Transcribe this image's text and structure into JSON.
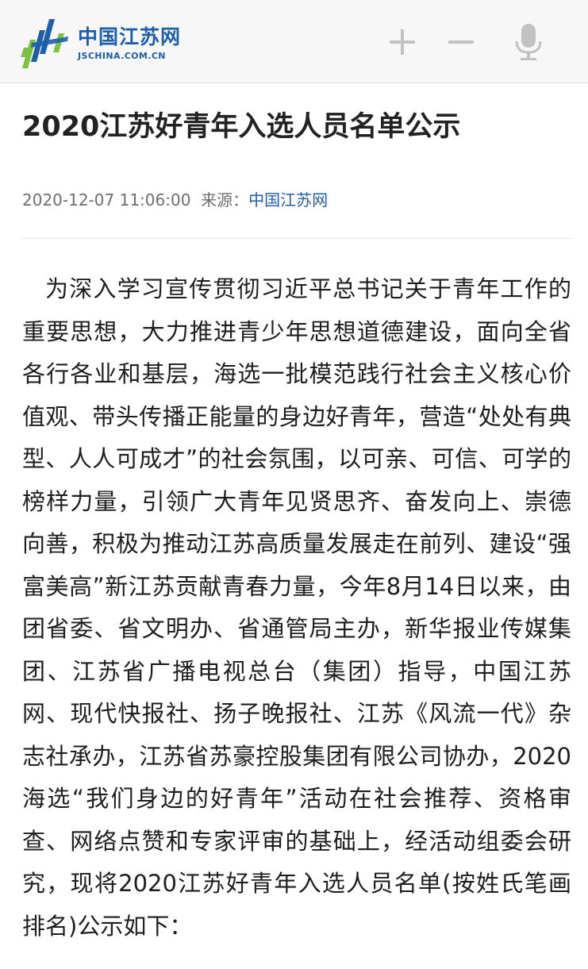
{
  "header": {
    "logo_cn": "中国江苏网",
    "logo_en": "JSCHINA.COM.CN",
    "icons": [
      "plus-icon",
      "minus-icon",
      "microphone-icon"
    ],
    "brand_color": "#1e5fa8",
    "logo_green": "#7bc142"
  },
  "article": {
    "title": "2020江苏好青年入选人员名单公示",
    "datetime": "2020-12-07 11:06:00",
    "source_label": "来源：",
    "source_name": "中国江苏网",
    "body": "为深入学习宣传贯彻习近平总书记关于青年工作的重要思想，大力推进青少年思想道德建设，面向全省各行各业和基层，海选一批模范践行社会主义核心价值观、带头传播正能量的身边好青年，营造“处处有典型、人人可成才”的社会氛围，以可亲、可信、可学的榜样力量，引领广大青年见贤思齐、奋发向上、崇德向善，积极为推动江苏高质量发展走在前列、建设“强富美高”新江苏贡献青春力量，今年8月14日以来，由团省委、省文明办、省通管局主办，新华报业传媒集团、江苏省广播电视总台（集团）指导，中国江苏网、现代快报社、扬子晚报社、江苏《风流一代》杂志社承办，江苏省苏豪控股集团有限公司协办，2020海选“我们身边的好青年”活动在社会推荐、资格审查、网络点赞和专家评审的基础上，经活动组委会研究，现将2020江苏好青年入选人员名单(按姓氏笔画排名)公示如下："
  }
}
